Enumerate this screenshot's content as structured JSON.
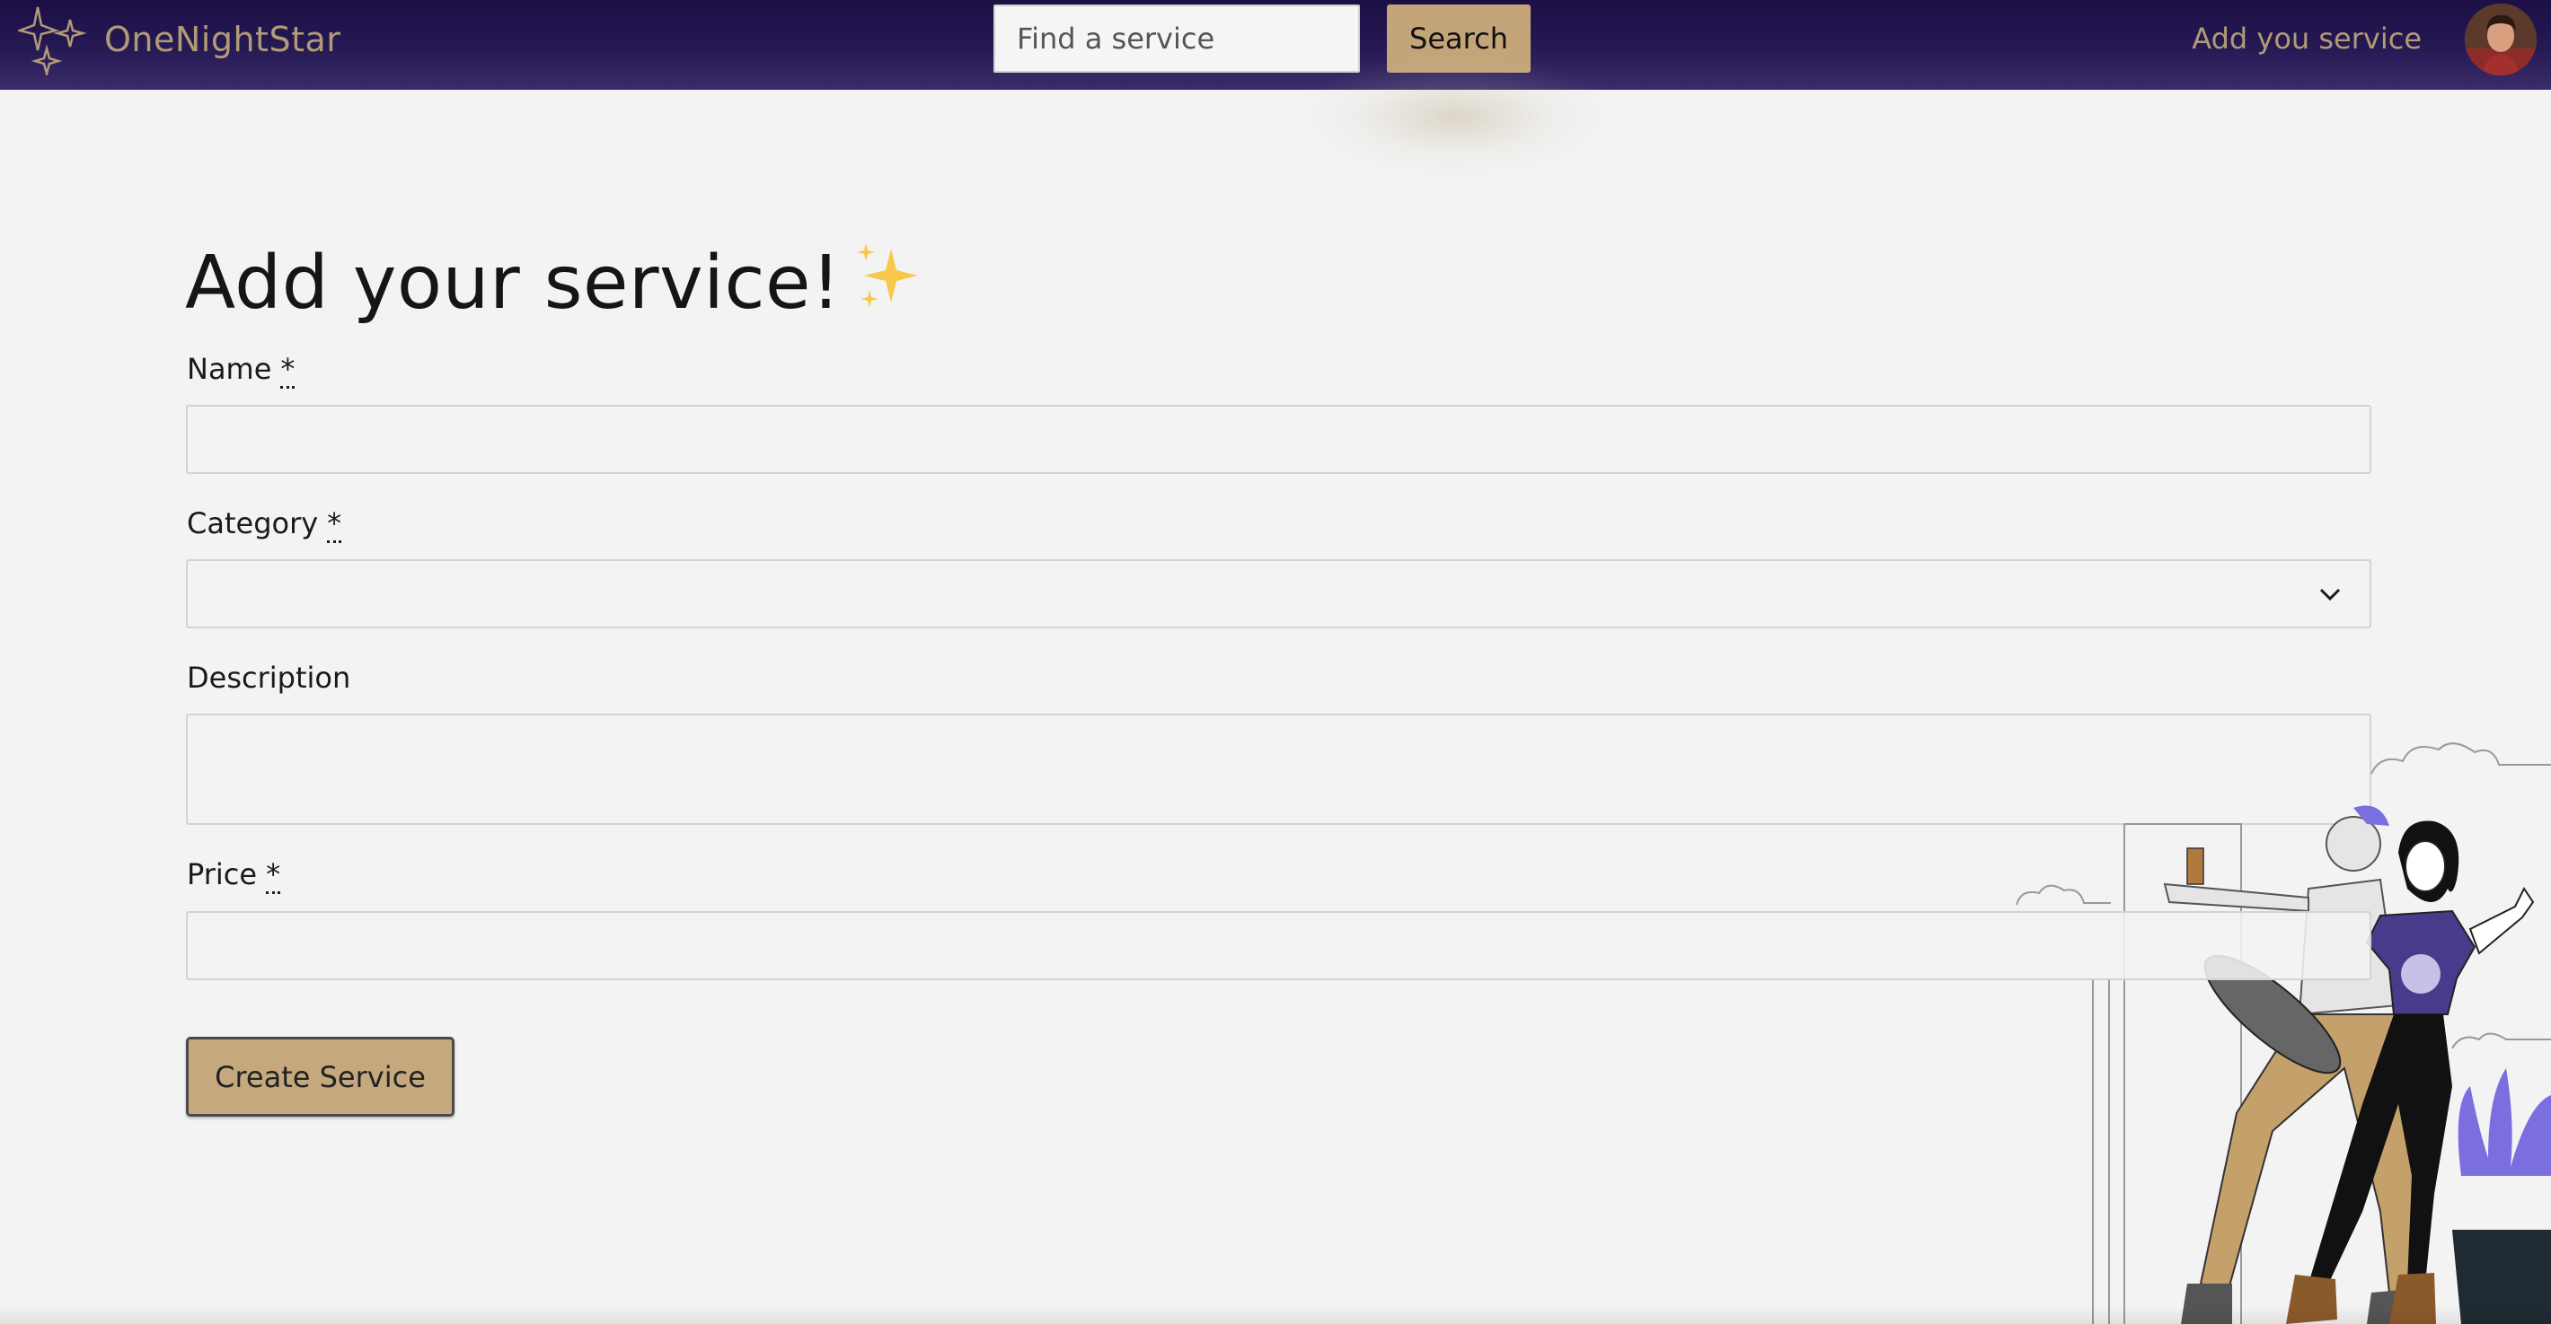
{
  "navbar": {
    "brand": "OneNightStar",
    "search_placeholder": "Find a service",
    "search_button": "Search",
    "add_link": "Add you service"
  },
  "form": {
    "title": "Add your service!",
    "title_emoji": "sparkles-icon",
    "fields": [
      {
        "label": "Name",
        "required": true,
        "value": ""
      },
      {
        "label": "Category",
        "required": true,
        "value": ""
      },
      {
        "label": "Description",
        "required": false,
        "value": ""
      },
      {
        "label": "Price",
        "required": true,
        "value": ""
      }
    ],
    "required_marker": "*",
    "submit_label": "Create Service"
  },
  "colors": {
    "nav_bg": "#1c0f45",
    "accent": "#c4a57a",
    "brand_text": "#b39a77",
    "page_bg": "#f3f3f3"
  }
}
